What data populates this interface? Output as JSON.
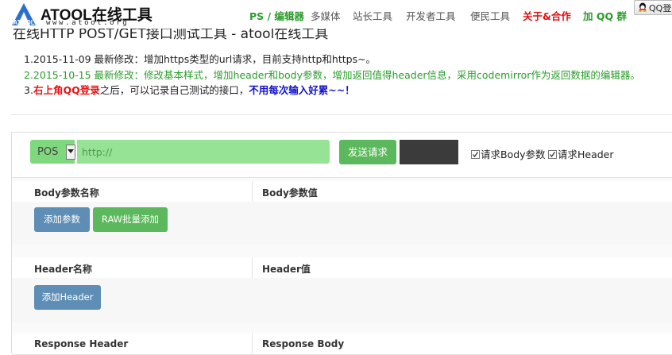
{
  "logo": {
    "text": "ATOOL在线工具",
    "sub": "www.atool.org",
    "mark": "ATOOL"
  },
  "nav": {
    "items": [
      {
        "label": "PS / 编辑器",
        "style": "green"
      },
      {
        "label": "多媒体",
        "style": "gray"
      },
      {
        "label": "站长工具",
        "style": "gray"
      },
      {
        "label": "开发者工具",
        "style": "gray"
      },
      {
        "label": "便民工具",
        "style": "gray"
      },
      {
        "label": "关于&合作",
        "style": "red"
      },
      {
        "label": "加 QQ 群",
        "style": "green"
      }
    ],
    "qq_login": "QQ登"
  },
  "page": {
    "subtitle": "在线HTTP POST/GET接口测试工具 - atool在线工具"
  },
  "notes": {
    "n1": "1.2015-11-09 最新修改：增加https类型的url请求，目前支持http和https~。",
    "n2": "2.2015-10-15 最新修改：修改基本样式，增加header和body参数，增加返回值得header信息，采用codemirror作为返回数据的编辑器。",
    "n3_prefix": "3.",
    "n3_red": "右上角QQ登录",
    "n3_middle": "之后，可以记录自己测试的接口，",
    "n3_blue": "不用每次输入好累~~！"
  },
  "request": {
    "method": "POS",
    "url_placeholder": "http://",
    "send_label": "发送请求",
    "cb_body": "请求Body参数",
    "cb_header": "请求Header",
    "cb_body_checked": true,
    "cb_header_checked": true
  },
  "body_section": {
    "col1": "Body参数名称",
    "col2": "Body参数值",
    "add": "添加参数",
    "raw": "RAW批量添加"
  },
  "header_section": {
    "col1": "Header名称",
    "col2": "Header值",
    "add": "添加Header"
  },
  "response_section": {
    "col1": "Response Header",
    "col2": "Response Body"
  },
  "colors": {
    "green": "#5cb85c",
    "blue": "#5e8eb5",
    "red": "#dd1111",
    "nav_green": "#2c9b2c"
  }
}
